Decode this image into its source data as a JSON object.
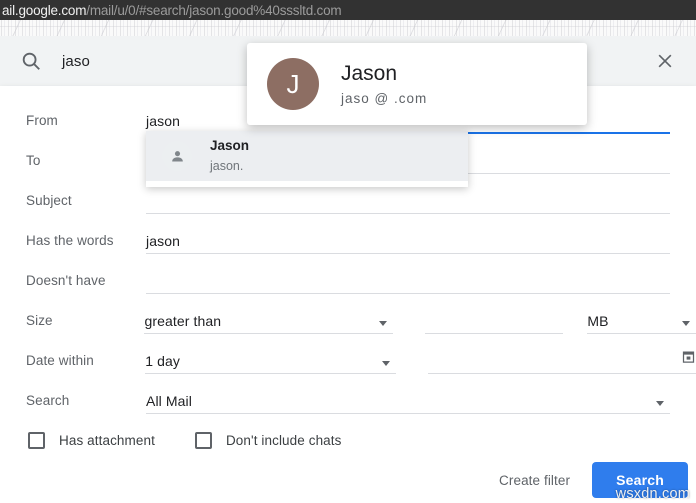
{
  "browser": {
    "url_domain": "ail.google.com",
    "url_path": "/mail/u/0/#search/jason.good%40sssltd.com"
  },
  "search_bar": {
    "icon": "search-icon",
    "query": "jaso",
    "close_icon": "close-icon"
  },
  "advanced_search": {
    "rows": {
      "from": {
        "label": "From",
        "value": "jason"
      },
      "to": {
        "label": "To",
        "value": ""
      },
      "subject": {
        "label": "Subject",
        "value": ""
      },
      "words": {
        "label": "Has the words",
        "value": "jason"
      },
      "nothave": {
        "label": "Doesn't have",
        "value": ""
      },
      "size": {
        "label": "Size",
        "operator": "greater than",
        "amount": "",
        "unit": "MB"
      },
      "date": {
        "label": "Date within",
        "operator": "1 day",
        "value": "",
        "icon": "calendar-icon"
      },
      "scope": {
        "label": "Search",
        "value": "All Mail"
      }
    },
    "checkboxes": [
      {
        "label": "Has attachment",
        "checked": false
      },
      {
        "label": "Don't include chats",
        "checked": false
      }
    ],
    "actions": {
      "create_filter": "Create filter",
      "search": "Search"
    }
  },
  "autocomplete": {
    "item": {
      "name": "Jason",
      "email": "jason.",
      "avatar_icon": "person-icon"
    }
  },
  "hovercard": {
    "avatar_initial": "J",
    "name": "Jason",
    "email": "jaso  @  .com"
  },
  "watermark": {
    "text": "wsxdn.com"
  },
  "colors": {
    "accent_blue": "#2f7ded",
    "focus_underline": "#1a73e8",
    "avatar_brown": "#8d6e63",
    "urlbar_bg": "#323232",
    "searchbar_bg": "#f1f3f4"
  }
}
